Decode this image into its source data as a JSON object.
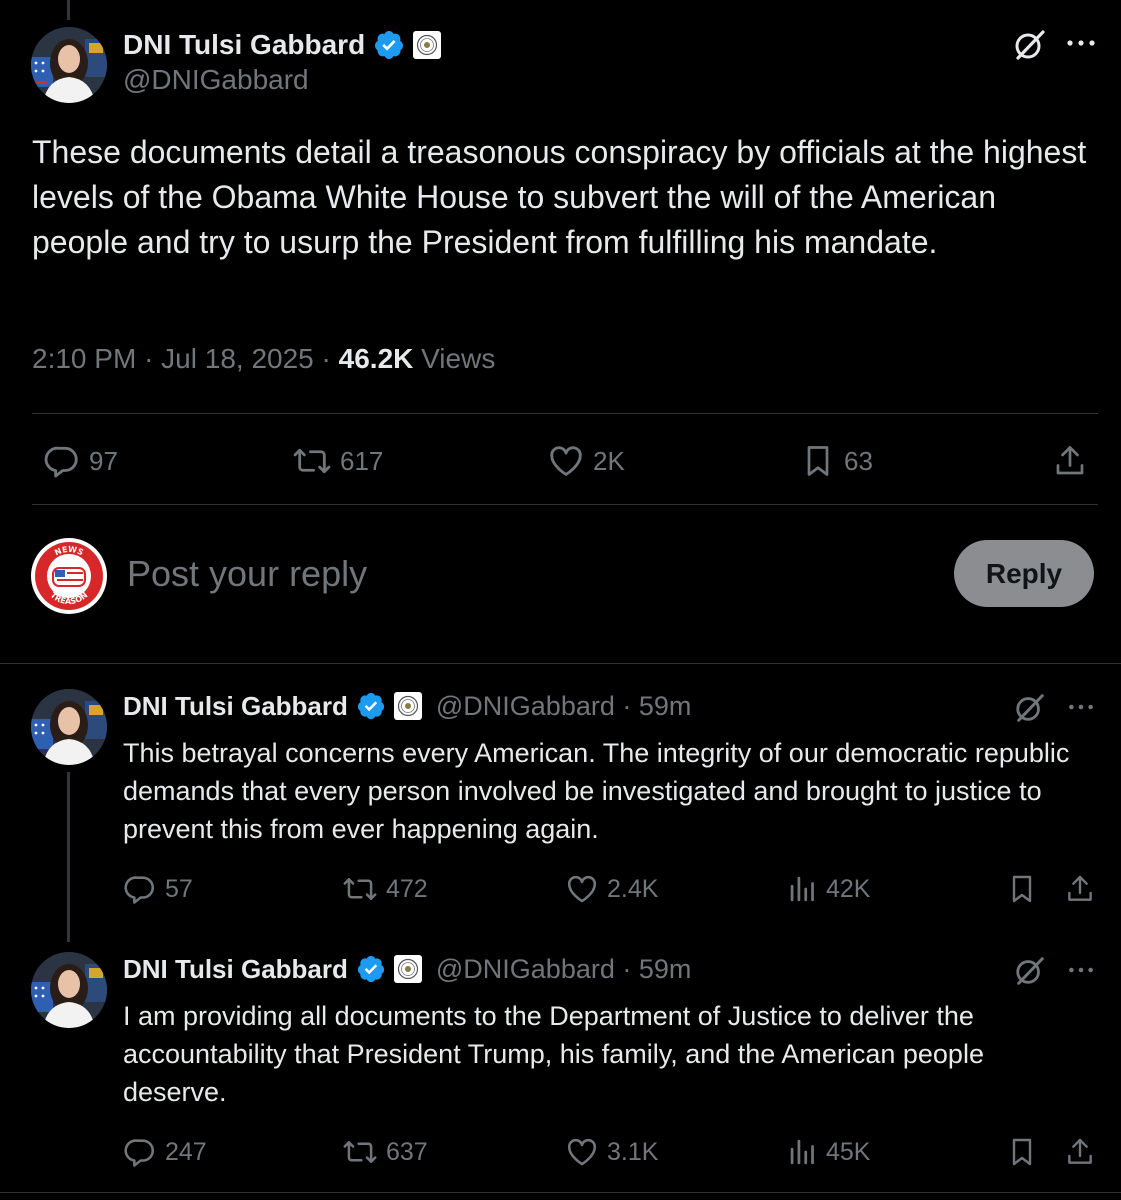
{
  "main_tweet": {
    "display_name": "DNI Tulsi Gabbard",
    "handle": "@DNIGabbard",
    "text": "These documents detail a treasonous conspiracy by officials at the highest levels of the Obama White House to subvert the will of the American people and try to usurp the President from fulfilling his mandate.",
    "time": "2:10 PM",
    "date": "Jul 18, 2025",
    "separator": "·",
    "views_count": "46.2K",
    "views_label": "Views",
    "stats": {
      "replies": "97",
      "reposts": "617",
      "likes": "2K",
      "bookmarks": "63"
    }
  },
  "reply_composer": {
    "placeholder": "Post your reply",
    "button_label": "Reply",
    "avatar_top_text": "NEWS",
    "avatar_bottom_text": "TREASON"
  },
  "replies": [
    {
      "display_name": "DNI Tulsi Gabbard",
      "handle_time": "@DNIGabbard · 59m",
      "text": "This betrayal concerns every American. The integrity of our democratic republic demands that every person involved be investigated and brought to justice to prevent this from ever happening again.",
      "stats": {
        "replies": "57",
        "reposts": "472",
        "likes": "2.4K",
        "views": "42K"
      }
    },
    {
      "display_name": "DNI Tulsi Gabbard",
      "handle_time": "@DNIGabbard · 59m",
      "text": "I am providing all documents to the Department of Justice to deliver the accountability that President Trump, his family, and the American people deserve.",
      "stats": {
        "replies": "247",
        "reposts": "637",
        "likes": "3.1K",
        "views": "45K"
      }
    }
  ],
  "colors": {
    "background": "#000000",
    "text_primary": "#e7e9ea",
    "text_secondary": "#71767b",
    "verified_blue": "#1d9bf0",
    "divider": "#2f3336",
    "reply_button": "#8b8d90"
  },
  "icons": [
    "verified-badge-icon",
    "government-seal-icon",
    "grok-icon",
    "more-icon",
    "reply-icon",
    "repost-icon",
    "like-icon",
    "bookmark-icon",
    "share-icon",
    "views-icon"
  ]
}
